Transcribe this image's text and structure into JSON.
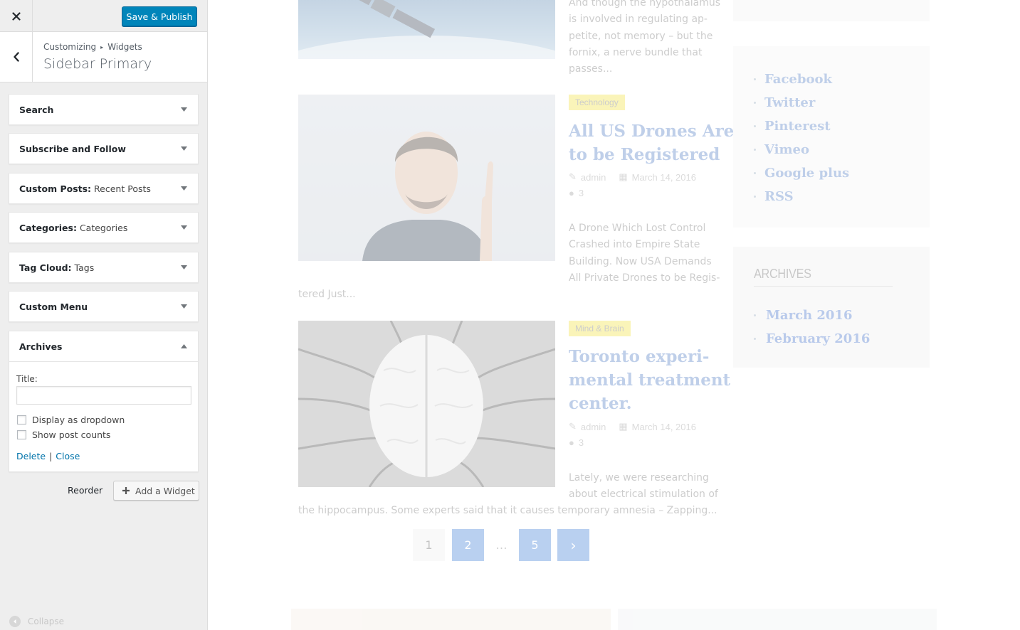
{
  "panel": {
    "close_icon": "close-icon",
    "publish_label": "Save & Publish",
    "breadcrumb": {
      "part1": "Customizing",
      "sep": "▸",
      "part2": "Widgets"
    },
    "section_title": "Sidebar Primary",
    "widgets": [
      {
        "title": "Search",
        "instance": ""
      },
      {
        "title": "Subscribe and Follow",
        "instance": ""
      },
      {
        "title": "Custom Posts:",
        "instance": "Recent Posts"
      },
      {
        "title": "Categories:",
        "instance": "Categories"
      },
      {
        "title": "Tag Cloud:",
        "instance": "Tags"
      },
      {
        "title": "Custom Menu",
        "instance": ""
      }
    ],
    "archives": {
      "title": "Archives",
      "field_label": "Title:",
      "field_value": "",
      "checkbox_dropdown": "Display as dropdown",
      "checkbox_counts": "Show post counts",
      "delete_link": "Delete",
      "separator": "|",
      "close_link": "Close"
    },
    "reorder_label": "Reorder",
    "add_widget_label": "Add a Widget",
    "collapse_label": "Collapse"
  },
  "preview": {
    "posts": [
      {
        "excerpt_lines": [
          "And though the hypothalamus",
          "is involved in regulating ap-",
          "petite, not memory – but the",
          "fornix, a nerve bundle that",
          "passes..."
        ]
      },
      {
        "tag": "Technology",
        "title_lines": [
          "All US Drones Are",
          "to be Registered"
        ],
        "author": "admin",
        "date": "March 14, 2016",
        "comments": "3",
        "excerpt_lines": [
          "A Drone Which Lost Control",
          "Crashed into Empire State",
          "Building. Now USA Demands",
          "All Private Drones to be Regis-"
        ],
        "excerpt_tail": "tered Just..."
      },
      {
        "tag": "Mind & Brain",
        "title_lines": [
          "Toronto experi-",
          "mental treatment",
          "center."
        ],
        "author": "admin",
        "date": "March 14, 2016",
        "comments": "3",
        "excerpt_lines": [
          "Lately, we were researching",
          "about electrical stimulation of"
        ],
        "excerpt_tail": "the hippocampus. Some experts said that it causes temporary amnesia – Zapping..."
      }
    ],
    "pagination": [
      "1",
      "2",
      "…",
      "5",
      "›"
    ],
    "social_links": [
      "Facebook",
      "Twitter",
      "Pinterest",
      "Vimeo",
      "Google plus",
      "RSS"
    ],
    "archives_heading": "ARCHIVES",
    "archives_links": [
      "March 2016",
      "February 2016"
    ]
  },
  "colors": {
    "primary_button": "#0085ba",
    "link_blue": "#0073aa",
    "post_title_blue": "#4a78c3",
    "tag_yellow": "#f2e23a",
    "pager_blue": "#3a7bd5"
  }
}
